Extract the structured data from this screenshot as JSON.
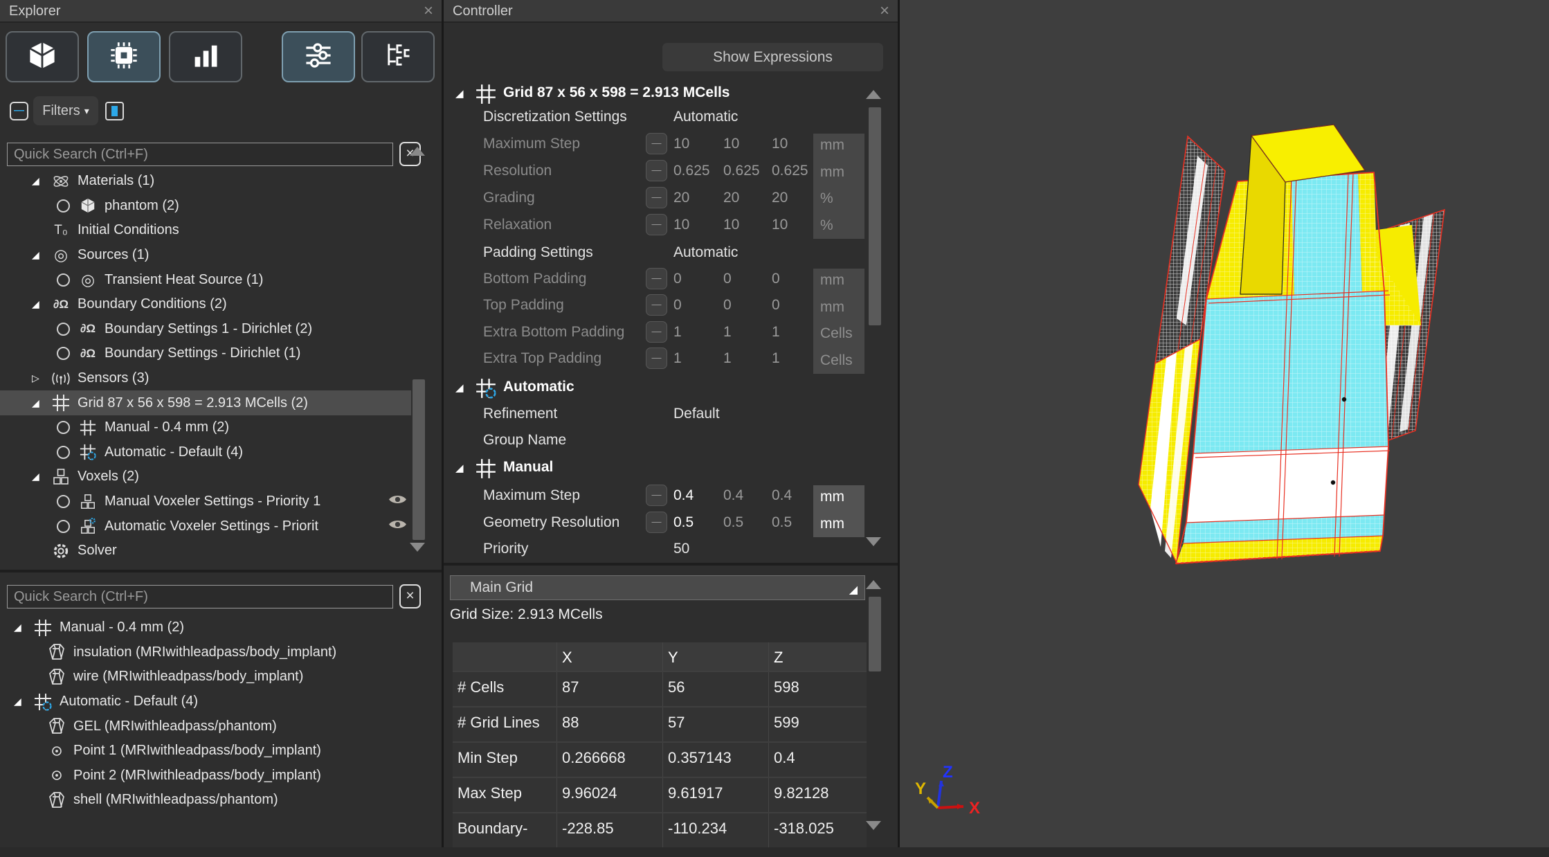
{
  "icons": {
    "expanded": "◢",
    "collapsed": "▷",
    "close": "×",
    "clear": "×",
    "chevron_down": "▾",
    "minus": "—",
    "corner_triangle": "◢",
    "source_glyph": "◎",
    "domega_glyph": "∂Ω",
    "t0_glyph": "T₀"
  },
  "colors": {
    "accent_blue": "#2da8e8",
    "selection_gray": "#4d4d4d",
    "model_yellow": "#f6ec00",
    "model_cyan": "#7ce9f2",
    "model_red": "#ff2a1a",
    "axis_x_red": "#ee2222",
    "axis_y_yellow": "#e0b000",
    "axis_z_blue": "#3344ff"
  },
  "explorer": {
    "title": "Explorer",
    "filters_label": "Filters",
    "search_placeholder": "Quick Search (Ctrl+F)",
    "search_placeholder2": "Quick Search (Ctrl+F)",
    "tree1": [
      "Materials (1)",
      "phantom (2)",
      "Initial Conditions",
      "Sources (1)",
      "Transient Heat Source (1)",
      "Boundary Conditions (2)",
      "Boundary Settings 1 - Dirichlet (2)",
      "Boundary Settings - Dirichlet (1)",
      "Sensors (3)",
      "Grid 87 x 56 x 598 = 2.913 MCells (2)",
      "Manual - 0.4 mm (2)",
      "Automatic - Default (4)",
      "Voxels (2)",
      "Manual Voxeler Settings - Priority 1",
      "Automatic Voxeler Settings - Priorit",
      "Solver"
    ],
    "tree2": [
      "Manual - 0.4 mm (2)",
      "insulation  (MRIwithleadpass/body_implant)",
      "wire  (MRIwithleadpass/body_implant)",
      "Automatic - Default (4)",
      "GEL  (MRIwithleadpass/phantom)",
      "Point 1  (MRIwithleadpass/body_implant)",
      "Point 2  (MRIwithleadpass/body_implant)",
      "shell  (MRIwithleadpass/phantom)"
    ]
  },
  "controller": {
    "title": "Controller",
    "show_expressions": "Show Expressions",
    "grid_header": "Grid 87 x 56 x 598 = 2.913 MCells",
    "rows": {
      "discretization": {
        "label": "Discretization Settings",
        "value": "Automatic"
      },
      "max_step": {
        "label": "Maximum Step",
        "v1": "10",
        "v2": "10",
        "v3": "10",
        "unit": "mm"
      },
      "resolution": {
        "label": "Resolution",
        "v1": "0.625",
        "v2": "0.625",
        "v3": "0.625",
        "unit": "mm"
      },
      "grading": {
        "label": "Grading",
        "v1": "20",
        "v2": "20",
        "v3": "20",
        "unit": "%"
      },
      "relaxation": {
        "label": "Relaxation",
        "v1": "10",
        "v2": "10",
        "v3": "10",
        "unit": "%"
      },
      "padding": {
        "label": "Padding Settings",
        "value": "Automatic"
      },
      "bottom_padding": {
        "label": "Bottom Padding",
        "v1": "0",
        "v2": "0",
        "v3": "0",
        "unit": "mm"
      },
      "top_padding": {
        "label": "Top Padding",
        "v1": "0",
        "v2": "0",
        "v3": "0",
        "unit": "mm"
      },
      "extra_bottom_padding": {
        "label": "Extra Bottom Padding",
        "v1": "1",
        "v2": "1",
        "v3": "1",
        "unit": "Cells"
      },
      "extra_top_padding": {
        "label": "Extra Top Padding",
        "v1": "1",
        "v2": "1",
        "v3": "1",
        "unit": "Cells"
      },
      "auto_header": "Automatic",
      "refinement": {
        "label": "Refinement",
        "value": "Default"
      },
      "group_name": {
        "label": "Group Name",
        "value": ""
      },
      "manual_header": "Manual",
      "man_max_step": {
        "label": "Maximum Step",
        "v1": "0.4",
        "v2": "0.4",
        "v3": "0.4",
        "unit": "mm"
      },
      "geometry_resolution": {
        "label": "Geometry Resolution",
        "v1": "0.5",
        "v2": "0.5",
        "v3": "0.5",
        "unit": "mm"
      },
      "priority": {
        "label": "Priority",
        "value": "50"
      }
    },
    "main_grid": {
      "header": "Main Grid",
      "size_label": "Grid Size: 2.913 MCells",
      "col_headers": [
        "X",
        "Y",
        "Z"
      ],
      "table": [
        {
          "label": "# Cells",
          "x": "87",
          "y": "56",
          "z": "598"
        },
        {
          "label": "# Grid Lines",
          "x": "88",
          "y": "57",
          "z": "599"
        },
        {
          "label": "Min Step",
          "x": "0.266668",
          "y": "0.357143",
          "z": "0.4"
        },
        {
          "label": "Max Step",
          "x": "9.96024",
          "y": "9.61917",
          "z": "9.82128"
        },
        {
          "label": "Boundary-",
          "x": "-228.85",
          "y": "-110.234",
          "z": "-318.025"
        }
      ]
    }
  },
  "viewport": {
    "axis": {
      "x": "X",
      "y": "Y",
      "z": "Z"
    }
  }
}
